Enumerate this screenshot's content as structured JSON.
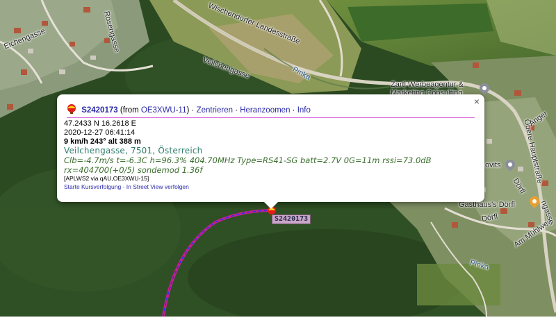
{
  "map": {
    "labels": {
      "eichengasse": "Eichengasse",
      "rosengasse": "Rosengasse",
      "wisch_street": "Wischendorfer Landesstraße",
      "veilchengasse": "Veilchengasse",
      "pinka_top": "Pinka",
      "pinka_bottom": "Pinka",
      "zartl": "Zartl Werbeagentur & Marketing Consulting",
      "obere_hauptstrasse": "Obere Hauptstraße",
      "anger": "Anger",
      "ovits": "ovits",
      "gasthaus": "Gasthaus's Dörfl",
      "am_muehlweg": "Am Mühlweg",
      "doerfl1": "Dörfl",
      "doerfl2": "Dörfl",
      "ngasse": "ngasse"
    },
    "colors": {
      "track": "#c0208c",
      "track_dash": "#2a2aff",
      "poi_grey": "#8a8f9a",
      "poi_orange": "#e8a030"
    }
  },
  "popup": {
    "id": "S2420173",
    "from_prefix": "(from ",
    "from_call": "OE3XWU-11",
    "from_suffix": ")",
    "sep1": " · ",
    "link_center": "Zentrieren",
    "sep2": " · ",
    "link_zoom": "Heranzoomen",
    "sep3": " · ",
    "link_info": "Info",
    "close": "×",
    "coords": "47.2433 N 16.2618 E",
    "datetime": "2020-12-27 06:41:14",
    "motion": "9 km/h 243° alt 388 m",
    "address": "Veilchengasse, 7501, Österreich",
    "telemetry1": "Clb=-4.7m/s t=-6.3C h=96.3% 404.70MHz Type=RS41-SG batt=2.7V 0G=11m rssi=73.0dB",
    "telemetry2": "rx=404700(+0/5) sondemod 1.36f",
    "path": "[APLWS2 via qAU,OE3XWU-15]",
    "link_track": "Starte Kursverfolgung",
    "link_sep": " · ",
    "link_streetview": "In Street View verfolgen"
  },
  "marker": {
    "label": "S2420173"
  }
}
